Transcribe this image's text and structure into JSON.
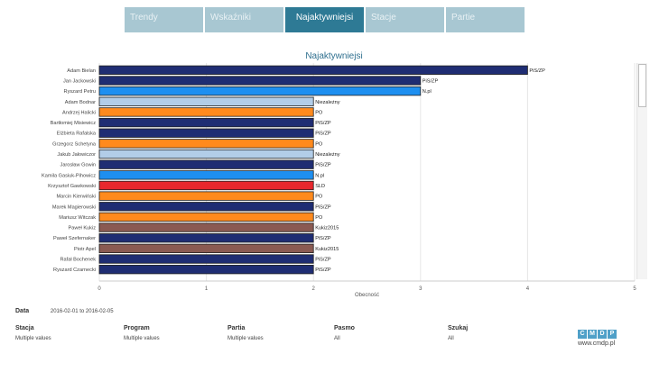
{
  "tabs": [
    {
      "label": "Trendy",
      "active": false
    },
    {
      "label": "Wskaźniki",
      "active": false
    },
    {
      "label": "Najaktywniejsi",
      "active": true
    },
    {
      "label": "Stacje",
      "active": false
    },
    {
      "label": "Partie",
      "active": false
    }
  ],
  "chart_title": "Najaktywniejsi",
  "party_colors": {
    "PiS/ZP": "#1f2d73",
    "N.pl": "#1e8ff0",
    "Niezależny": "#b2cde8",
    "PO": "#ff8a1d",
    "SLD": "#e8282d",
    "Kukiz2015": "#8a5a52"
  },
  "chart_data": {
    "type": "bar",
    "orientation": "horizontal",
    "xlabel": "Obecność",
    "xlim": [
      0,
      5
    ],
    "xticks": [
      "0",
      "1",
      "2",
      "3",
      "4",
      "5"
    ],
    "grid": true,
    "rows": [
      {
        "name": "Adam Bielan",
        "value": 4,
        "party": "PiS/ZP"
      },
      {
        "name": "Jan Jackowski",
        "value": 3,
        "party": "PiS/ZP"
      },
      {
        "name": "Ryszard Petru",
        "value": 3,
        "party": "N.pl"
      },
      {
        "name": "Adam Bodnar",
        "value": 2,
        "party": "Niezależny"
      },
      {
        "name": "Andrzej Halicki",
        "value": 2,
        "party": "PO"
      },
      {
        "name": "Bartłomiej Misiewicz",
        "value": 2,
        "party": "PiS/ZP"
      },
      {
        "name": "Elżbieta Rafalska",
        "value": 2,
        "party": "PiS/ZP"
      },
      {
        "name": "Grzegorz Schetyna",
        "value": 2,
        "party": "PO"
      },
      {
        "name": "Jakub Jałowiczor",
        "value": 2,
        "party": "Niezależny"
      },
      {
        "name": "Jarosław Gowin",
        "value": 2,
        "party": "PiS/ZP"
      },
      {
        "name": "Kamila Gasiuk-Pihowicz",
        "value": 2,
        "party": "N.pl"
      },
      {
        "name": "Krzysztof Gawkowski",
        "value": 2,
        "party": "SLD"
      },
      {
        "name": "Marcin Kierwiński",
        "value": 2,
        "party": "PO"
      },
      {
        "name": "Marek Magierowski",
        "value": 2,
        "party": "PiS/ZP"
      },
      {
        "name": "Mariusz Witczak",
        "value": 2,
        "party": "PO"
      },
      {
        "name": "Paweł Kukiz",
        "value": 2,
        "party": "Kukiz2015"
      },
      {
        "name": "Paweł Szefernaker",
        "value": 2,
        "party": "PiS/ZP"
      },
      {
        "name": "Piotr Apel",
        "value": 2,
        "party": "Kukiz2015"
      },
      {
        "name": "Rafał Bochenek",
        "value": 2,
        "party": "PiS/ZP"
      },
      {
        "name": "Ryszard Czarnecki",
        "value": 2,
        "party": "PiS/ZP"
      }
    ]
  },
  "filters": {
    "data_label": "Data",
    "data_value": "2016-02-01 to 2016-02-05",
    "items": [
      {
        "title": "Stacja",
        "value": "Multiple values"
      },
      {
        "title": "Program",
        "value": "Multiple values"
      },
      {
        "title": "Partia",
        "value": "Multiple values"
      },
      {
        "title": "Pasmo",
        "value": "All"
      },
      {
        "title": "Szukaj",
        "value": "All"
      }
    ]
  },
  "logo": {
    "letters": [
      "C",
      "M",
      "D",
      "P"
    ],
    "url": "www.cmdp.pl"
  }
}
